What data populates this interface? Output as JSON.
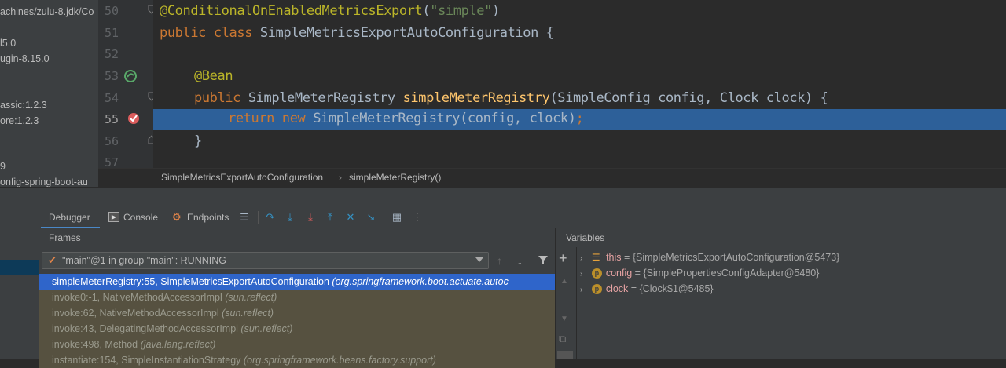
{
  "project_tree": {
    "rows": [
      "achines/zulu-8.jdk/Co",
      "l5.0",
      "ugin-8.15.0",
      "assic:1.2.3",
      "ore:1.2.3",
      "9",
      "onfig-spring-boot-au"
    ]
  },
  "editor": {
    "line_numbers": [
      "50",
      "51",
      "52",
      "53",
      "54",
      "55",
      "56",
      "57"
    ],
    "line50": {
      "annotation": "@ConditionalOnEnabledMetricsExport",
      "paren_open": "(",
      "string": "\"simple\"",
      "paren_close": ")"
    },
    "line51": {
      "kw1": "public",
      "kw2": "class",
      "name": " SimpleMetricsExportAutoConfiguration {"
    },
    "line53": {
      "annotation": "@Bean"
    },
    "line54": {
      "kw": "public",
      "type": " SimpleMeterRegistry ",
      "method": "simpleMeterRegistry",
      "params": "(SimpleConfig config, Clock clock) {"
    },
    "line55": {
      "kw1": "return",
      "kw2": "new",
      "rest": " SimpleMeterRegistry(config, clock)",
      "semi": ";"
    },
    "line56": {
      "text": "}"
    }
  },
  "breadcrumb": {
    "class_name": "SimpleMetricsExportAutoConfiguration",
    "separator": "›",
    "method": "simpleMeterRegistry()"
  },
  "debug_toolbar": {
    "tabs": {
      "debugger": "Debugger",
      "console": "Console",
      "endpoints": "Endpoints"
    }
  },
  "frames_panel": {
    "title": "Frames",
    "thread": "\"main\"@1 in group \"main\": RUNNING",
    "frames": [
      {
        "method": "simpleMeterRegistry:55, SimpleMetricsExportAutoConfiguration",
        "pkg": "(org.springframework.boot.actuate.autoc"
      },
      {
        "method": "invoke0:-1, NativeMethodAccessorImpl",
        "pkg": "(sun.reflect)"
      },
      {
        "method": "invoke:62, NativeMethodAccessorImpl",
        "pkg": "(sun.reflect)"
      },
      {
        "method": "invoke:43, DelegatingMethodAccessorImpl",
        "pkg": "(sun.reflect)"
      },
      {
        "method": "invoke:498, Method",
        "pkg": "(java.lang.reflect)"
      },
      {
        "method": "instantiate:154, SimpleInstantiationStrategy",
        "pkg": "(org.springframework.beans.factory.support)"
      }
    ]
  },
  "variables_panel": {
    "title": "Variables",
    "vars": [
      {
        "name": "this",
        "value": "{SimpleMetricsExportAutoConfiguration@5473}"
      },
      {
        "name": "config",
        "value": "{SimplePropertiesConfigAdapter@5480}"
      },
      {
        "name": "clock",
        "value": "{Clock$1@5485}"
      }
    ]
  },
  "colors": {
    "accent": "#2d6099",
    "selection": "#2f65ca",
    "keyword": "#cc7832",
    "annotation": "#bbb529"
  }
}
